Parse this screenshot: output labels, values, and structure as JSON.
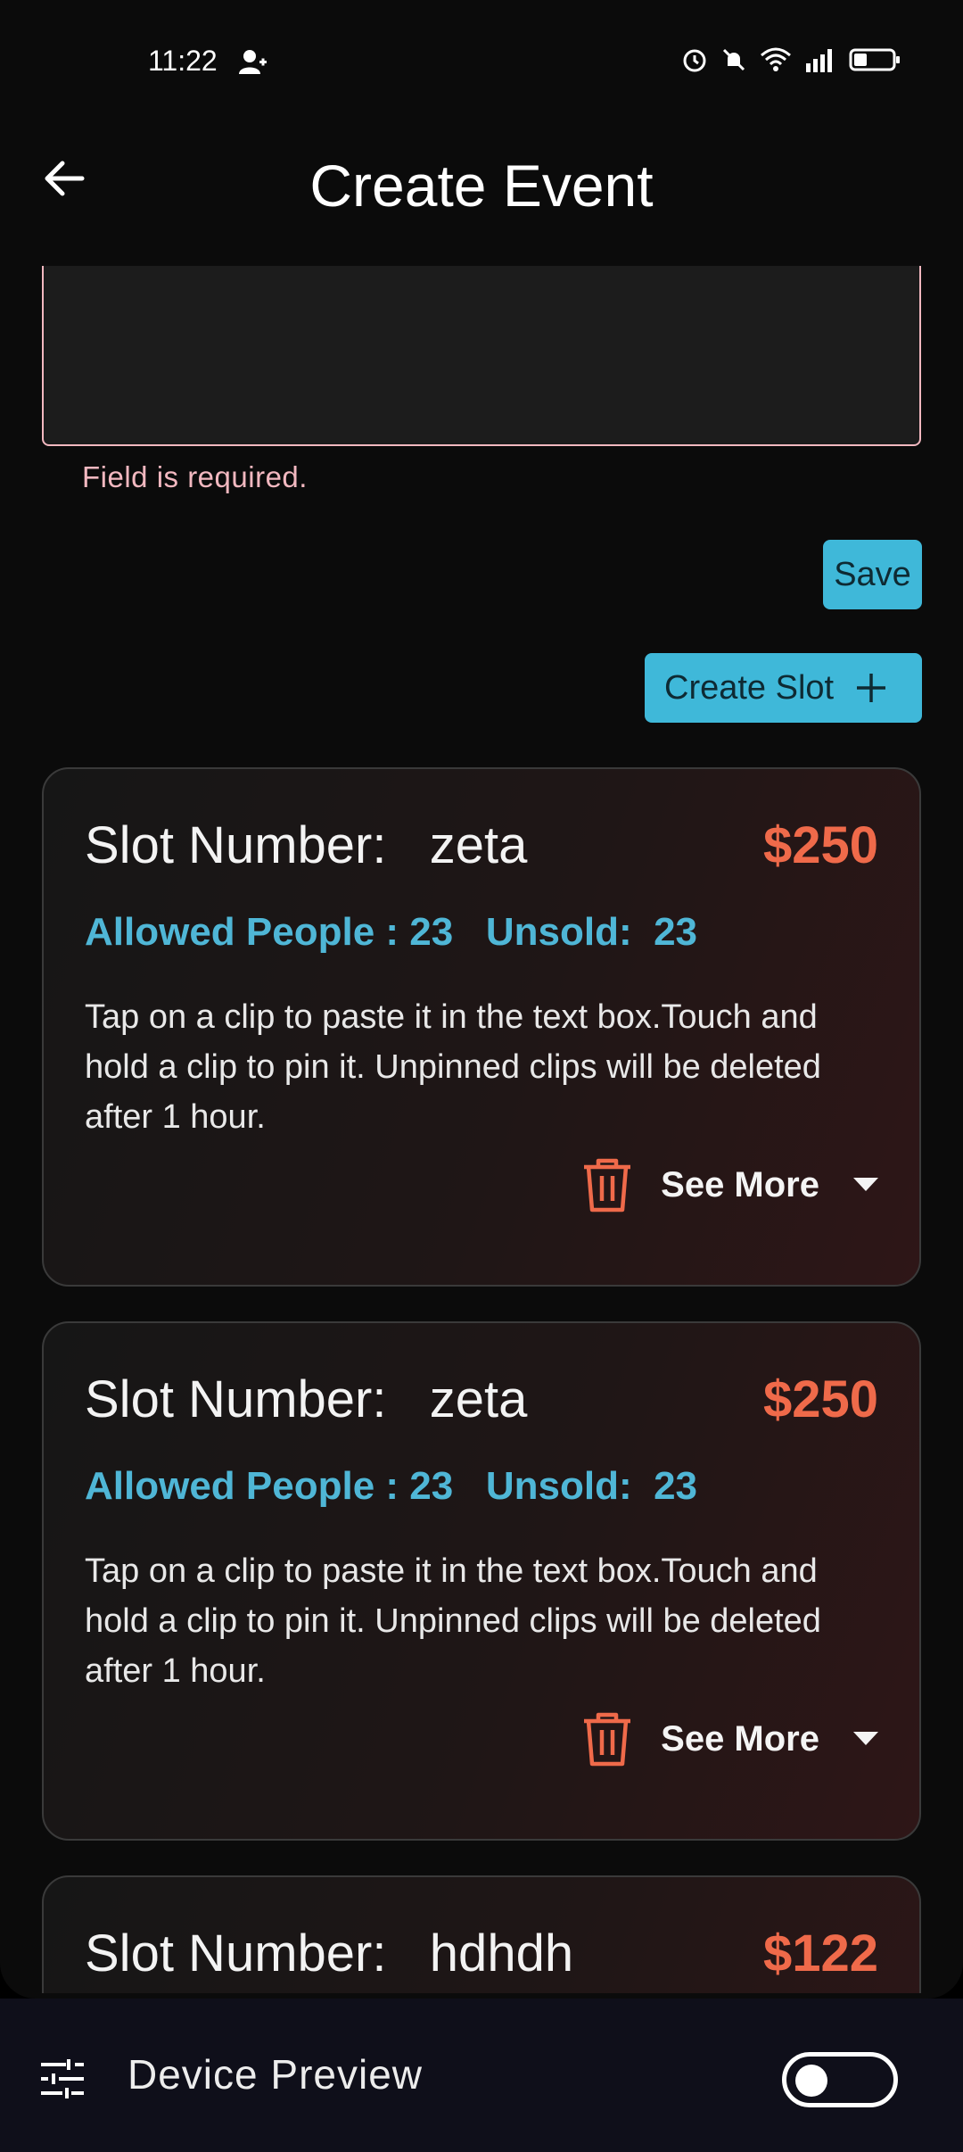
{
  "status_bar": {
    "time": "11:22"
  },
  "app_bar": {
    "title": "Create Event"
  },
  "form": {
    "error_text": "Field is required.",
    "save_label": "Save",
    "create_slot_label": "Create Slot"
  },
  "slots": [
    {
      "title": "Slot Number:   zeta",
      "price": "$250",
      "meta": "Allowed People : 23   Unsold:  23",
      "description": "Tap on a clip to paste it in the text box.Touch and hold a clip to pin it. Unpinned clips will be deleted after 1 hour.",
      "see_more": "See More"
    },
    {
      "title": "Slot Number:   zeta",
      "price": "$250",
      "meta": "Allowed People : 23   Unsold:  23",
      "description": "Tap on a clip to paste it in the text box.Touch and hold a clip to pin it. Unpinned clips will be deleted after 1 hour.",
      "see_more": "See More"
    },
    {
      "title": "Slot Number:   hdhdh",
      "price": "$122"
    }
  ],
  "device_preview": {
    "label": "Device Preview",
    "enabled": false
  },
  "colors": {
    "accent": "#3fb8d9",
    "price": "#ef6a4a",
    "meta": "#4fb6d6",
    "error": "#f2b8c0"
  }
}
